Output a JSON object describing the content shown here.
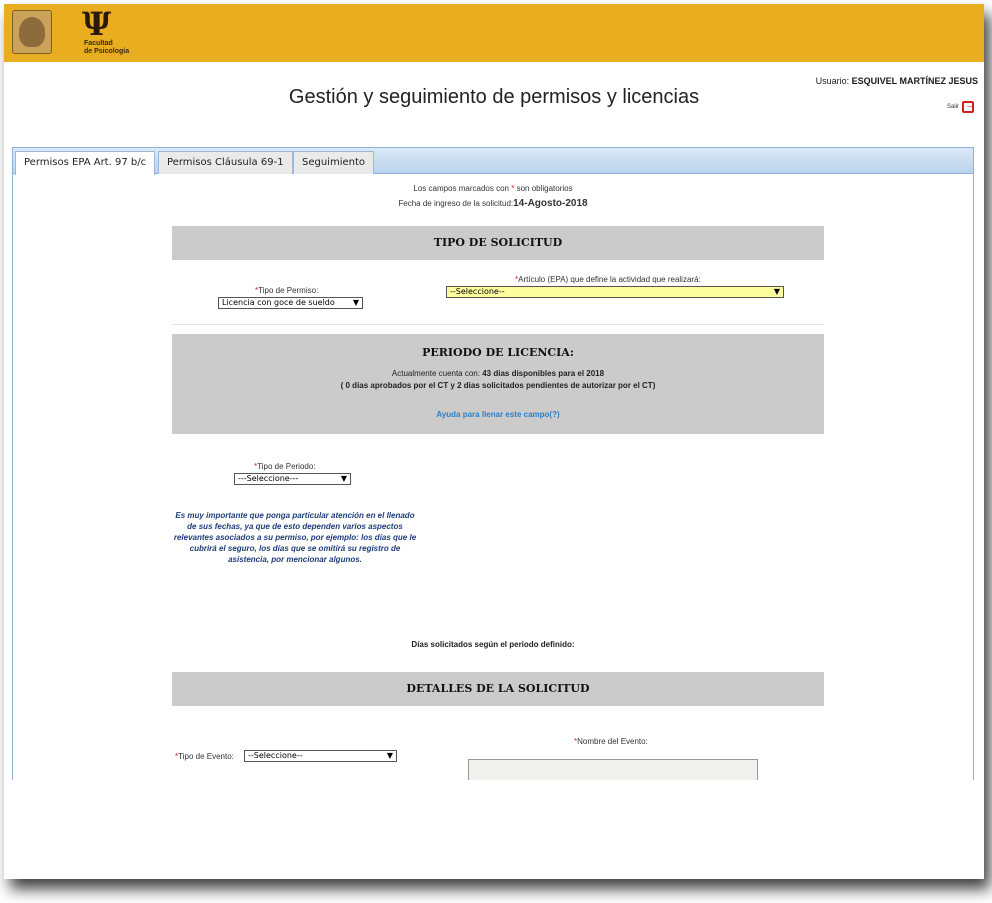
{
  "header": {
    "unam_logo": "unam-shield-logo",
    "faculty_logo_text_line1": "Facultad",
    "faculty_logo_text_line2": "de Psicología",
    "user_prefix": "Usuario:",
    "user_name": "ESQUIVEL MARTÍNEZ JESUS",
    "title": "Gestión y seguimiento de permisos y licencias",
    "logout_label": "Salir",
    "logout_icon": "logout-icon"
  },
  "tabs": [
    {
      "label": "Permisos EPA Art. 97 b/c",
      "active": true
    },
    {
      "label": "Permisos Cláusula 69-1",
      "active": false
    },
    {
      "label": "Seguimiento",
      "active": false
    }
  ],
  "form": {
    "required_note_prefix": "Los campos marcados con",
    "required_star": "*",
    "required_note_suffix": "son obligatorios",
    "date_label": "Fecha de ingreso de la solicitud:",
    "date_value": "14-Agosto-2018",
    "section_tipo": "TIPO DE SOLICITUD",
    "tipo_permiso_label": "Tipo de Permiso:",
    "tipo_permiso_value": "Licencia con goce de sueldo",
    "articulo_label": "Artículo (EPA) que define la actividad que realizará:",
    "articulo_value": "--Seleccione--",
    "section_periodo": "PERIODO DE LICENCIA:",
    "cuenta_prefix": "Actualmente cuenta con:",
    "cuenta_value": "43 dias disponibles para el 2018",
    "cuenta_detail": "( 0 dias aprobados por el CT y 2 dias solicitados pendientes de autorizar por el CT)",
    "help_link": "Ayuda para llenar este campo(?)",
    "tipo_periodo_label": "Tipo de Periodo:",
    "tipo_periodo_value": "---Seleccione---",
    "warning_text": "Es muy importante que ponga particular atención en el llenado de sus fechas, ya que de esto dependen varios aspectos relevantes asociados a su permiso, por ejemplo: los días que le cubrirá el seguro, los días que se omitirá su registro de asistencia, por mencionar algunos.",
    "dias_label": "Días solicitados según el periodo definido:",
    "section_detalles": "DETALLES DE LA SOLICITUD",
    "tipo_evento_label": "Tipo de Evento:",
    "tipo_evento_value": "--Seleccione--",
    "nombre_evento_label": "Nombre del Evento:"
  },
  "colors": {
    "header_bg": "#e8ae1f",
    "section_bg": "#cbcbcb",
    "required": "#e01b1b",
    "link": "#2e7fc6",
    "warning_text": "#1e3c7a",
    "highlight_select": "#fdfd9e"
  }
}
